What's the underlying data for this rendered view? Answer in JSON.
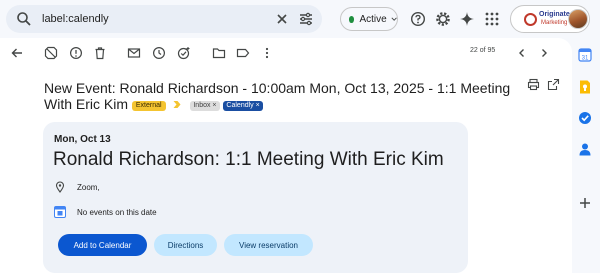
{
  "search": {
    "value": "label:calendly"
  },
  "status": {
    "label": "Active",
    "color": "#1e8e3e"
  },
  "account": {
    "brand_line1": "Originate",
    "brand_line2": "Marketing"
  },
  "toolbar": {
    "pager": "22 of 95"
  },
  "email": {
    "subject": "New Event: Ronald Richardson - 10:00am Mon, Oct 13, 2025 - 1:1 Meeting With Eric Kim",
    "labels": [
      "External",
      "Inbox",
      "Calendly"
    ]
  },
  "event": {
    "date": "Mon, Oct 13",
    "title": "Ronald Richardson: 1:1 Meeting With Eric Kim",
    "location": "Zoom,",
    "calendar_status": "No events on this date",
    "buttons": {
      "add": "Add to Calendar",
      "directions": "Directions",
      "view": "View reservation"
    }
  },
  "colors": {
    "primary": "#0b57d0",
    "secondary": "#c2e7ff",
    "external": "#f4c430",
    "calendly": "#1a4ea2"
  },
  "icons": [
    "search-icon",
    "clear-icon",
    "tune-icon",
    "help-icon",
    "settings-icon",
    "gemini-icon",
    "apps-icon",
    "back-icon",
    "report-spam-icon",
    "report-icon",
    "delete-icon",
    "mark-unread-icon",
    "snooze-icon",
    "add-task-icon",
    "move-icon",
    "label-icon",
    "more-icon",
    "prev-icon",
    "next-icon",
    "print-icon",
    "open-new-window-icon",
    "location-icon",
    "calendar-icon",
    "keep-icon",
    "tasks-icon",
    "contacts-icon",
    "add-icon"
  ]
}
